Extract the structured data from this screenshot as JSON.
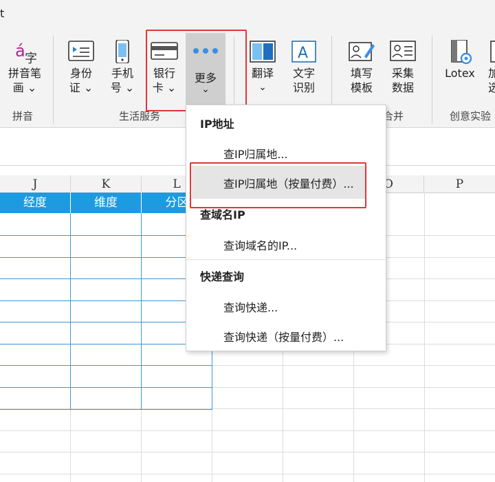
{
  "window": {
    "title_fragment": "t"
  },
  "ribbon": {
    "tools": {
      "pinyin": {
        "label1": "拼音笔",
        "label2": "画 ⌄"
      },
      "idcard": {
        "label1": "身份",
        "label2": "证 ⌄"
      },
      "phone": {
        "label1": "手机",
        "label2": "号 ⌄"
      },
      "bankcard": {
        "label1": "银行",
        "label2": "卡 ⌄"
      },
      "more": {
        "label": "更多",
        "chevron": "⌄"
      },
      "translate": {
        "label": "翻译",
        "chevron": "⌄"
      },
      "ocr": {
        "label1": "文字",
        "label2": "识别"
      },
      "fill_template": {
        "label1": "填写",
        "label2": "模板"
      },
      "collect": {
        "label1": "采集",
        "label2": "数据"
      },
      "lotex": {
        "label": "Lotex"
      },
      "add_partial": {
        "label1": "加",
        "label2": "选"
      }
    },
    "groups": {
      "pinyin": "拼音",
      "life_services": "生活服务",
      "merge": "合并",
      "creative": "创意实验"
    }
  },
  "sheet": {
    "columns": [
      "J",
      "K",
      "L",
      "O",
      "P"
    ],
    "header_cells": [
      "经度",
      "维度",
      "分区"
    ]
  },
  "menu": {
    "section_ip": "IP地址",
    "item_ip_lookup": "查IP归属地...",
    "item_ip_lookup_paid": "查IP归属地（按量付费）...",
    "section_domain": "查域名IP",
    "item_domain_ip": "查询域名的IP...",
    "section_express": "快递查询",
    "item_express": "查询快递...",
    "item_express_paid": "查询快递（按量付费）..."
  },
  "colors": {
    "accent": "#1e9be0",
    "highlight_box": "#e03535",
    "hover": "#e5e5e5"
  }
}
